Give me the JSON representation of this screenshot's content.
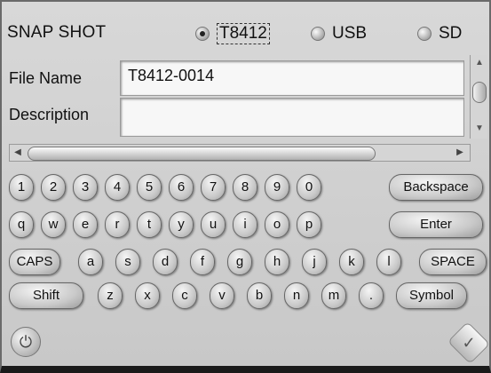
{
  "header": {
    "title": "SNAP SHOT",
    "options": [
      {
        "label": "T8412",
        "selected": true
      },
      {
        "label": "USB",
        "selected": false
      },
      {
        "label": "SD",
        "selected": false
      }
    ]
  },
  "fields": {
    "file_name": {
      "label": "File Name",
      "value": "T8412-0014"
    },
    "description": {
      "label": "Description",
      "value": ""
    }
  },
  "keyboard": {
    "row1": [
      "1",
      "2",
      "3",
      "4",
      "5",
      "6",
      "7",
      "8",
      "9",
      "0",
      "Backspace"
    ],
    "row2": [
      "q",
      "w",
      "e",
      "r",
      "t",
      "y",
      "u",
      "i",
      "o",
      "p",
      "Enter"
    ],
    "row3": [
      "CAPS",
      "a",
      "s",
      "d",
      "f",
      "g",
      "h",
      "j",
      "k",
      "l",
      "SPACE"
    ],
    "row4": [
      "Shift",
      "z",
      "x",
      "c",
      "v",
      "b",
      "n",
      "m",
      ".",
      "Symbol"
    ]
  },
  "icons": {
    "power": "power-icon",
    "confirm": "checkmark-icon",
    "scroll_left": "arrow-left-icon",
    "scroll_right": "arrow-right-icon",
    "scroll_up": "arrow-up-icon",
    "scroll_down": "arrow-down-icon"
  }
}
